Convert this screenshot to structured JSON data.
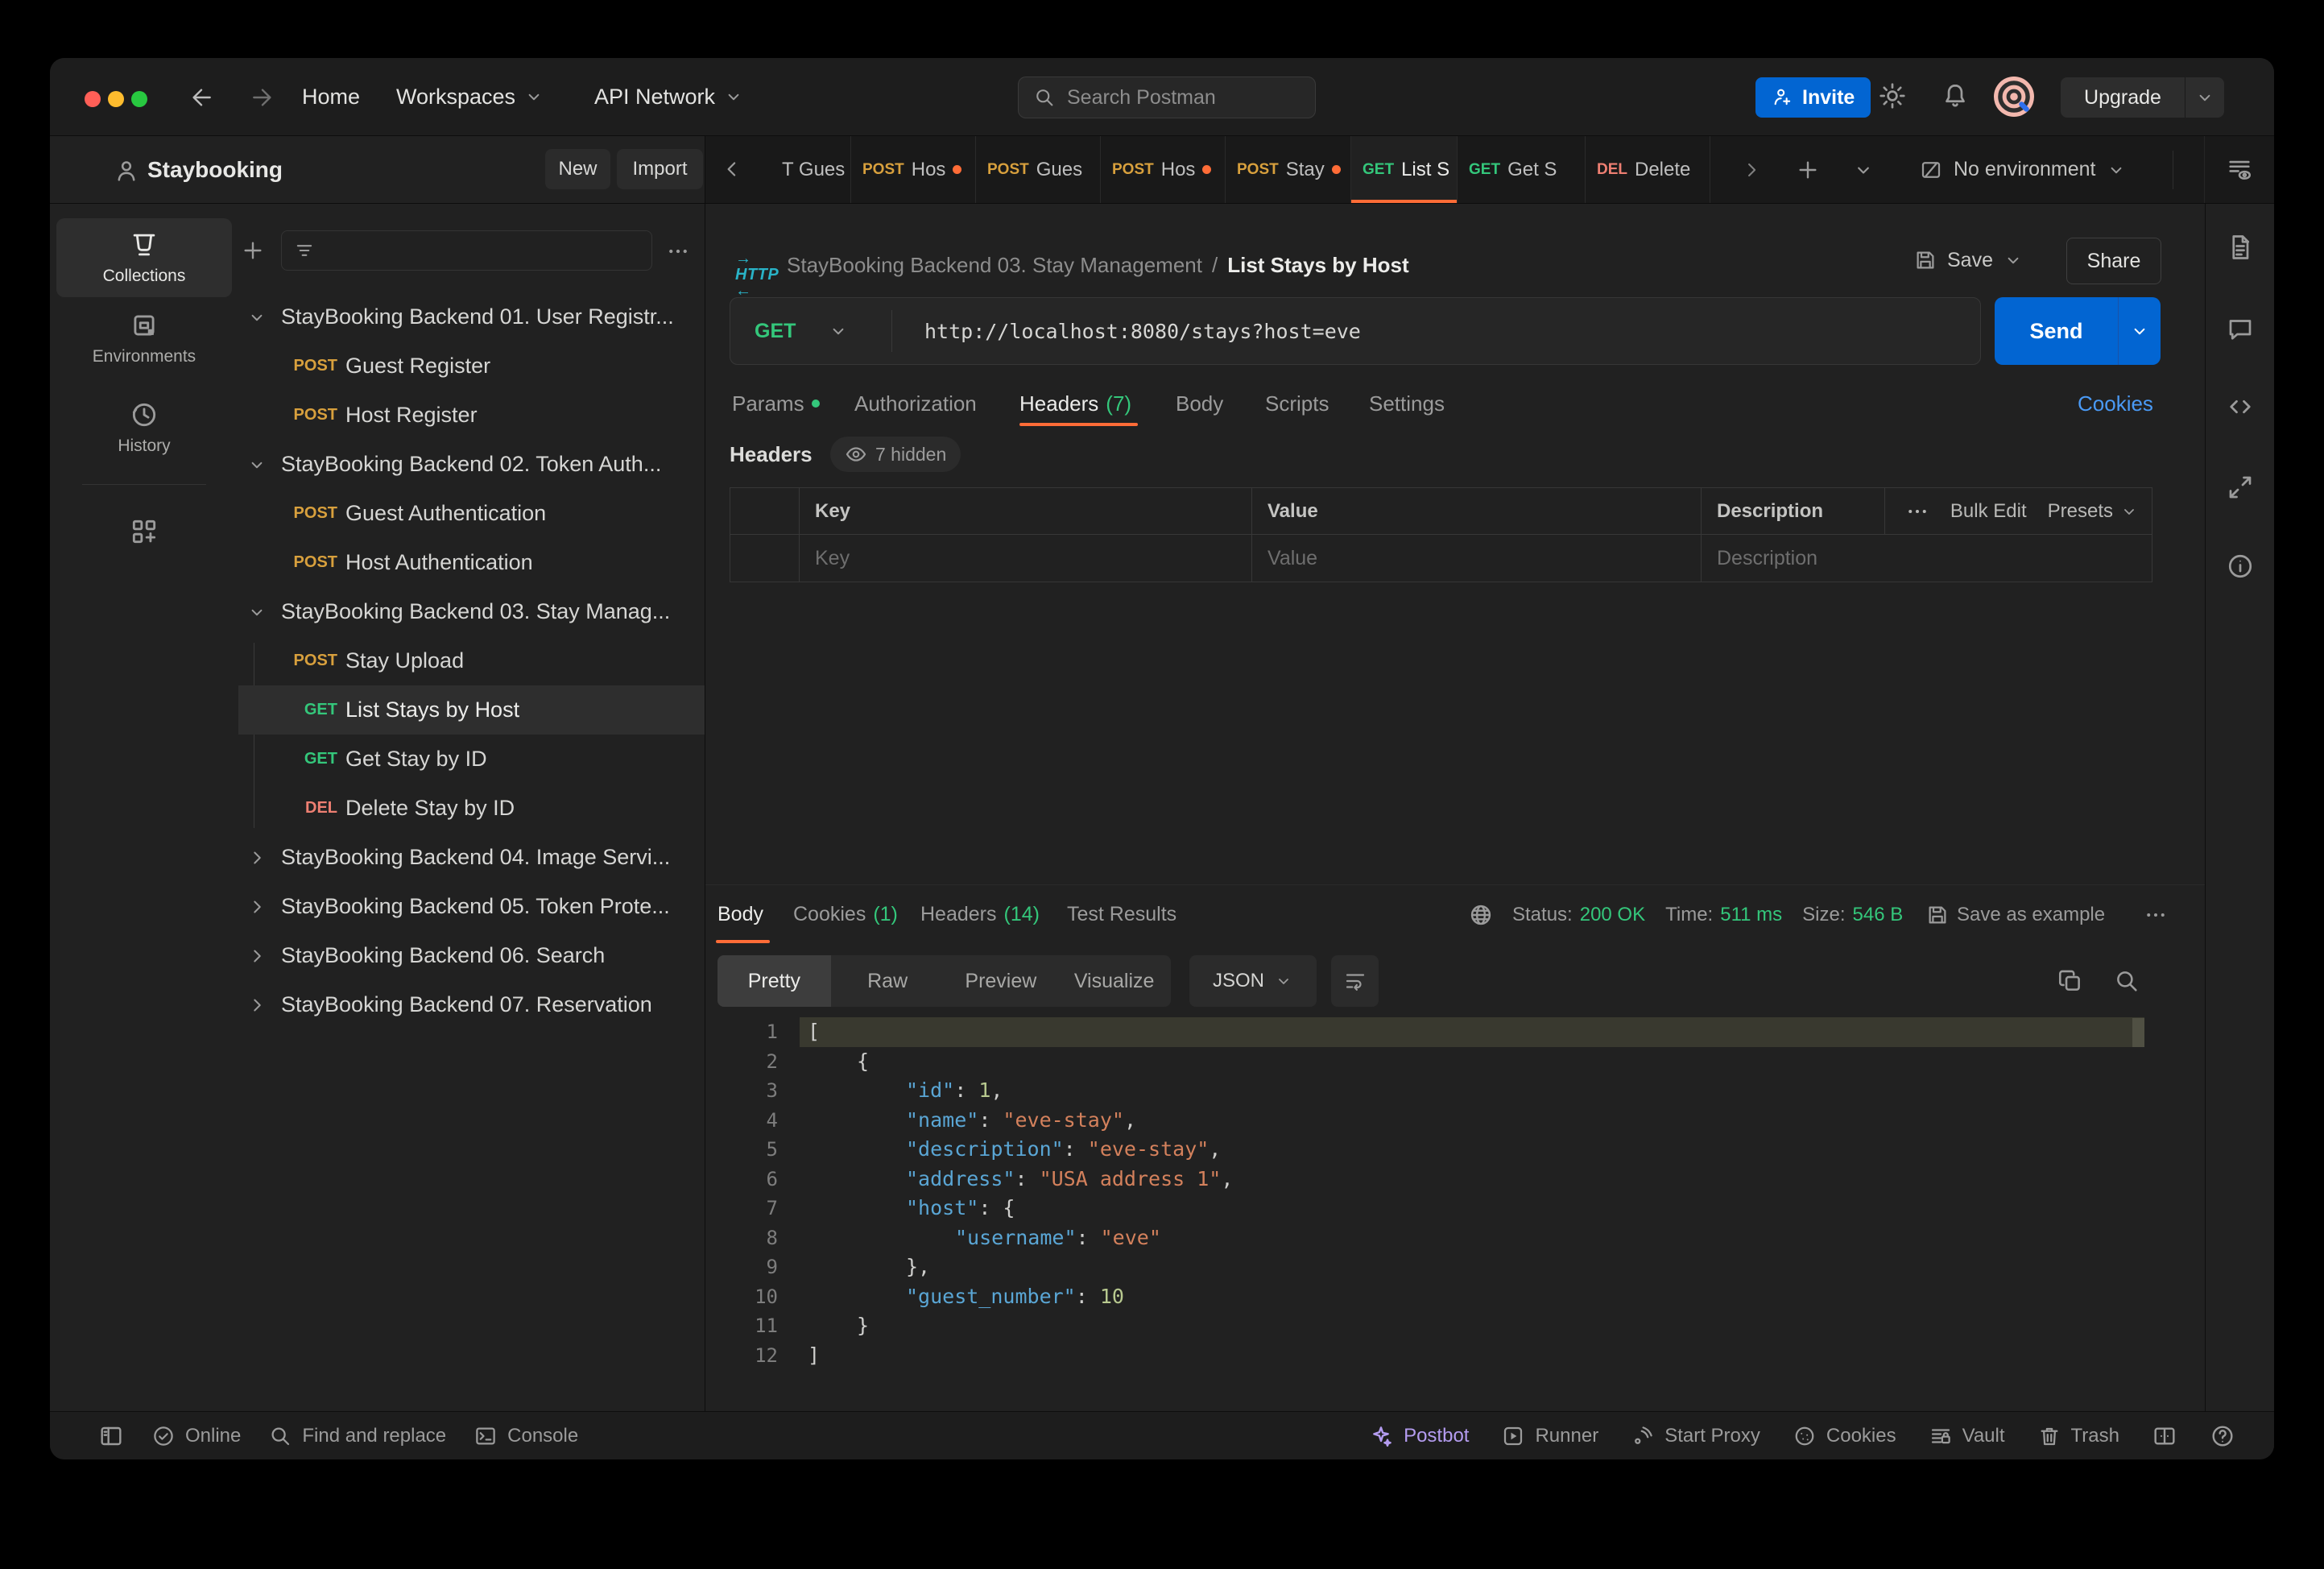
{
  "topbar": {
    "nav": {
      "home": "Home",
      "workspaces": "Workspaces",
      "api_network": "API Network"
    },
    "search_placeholder": "Search Postman",
    "invite_label": "Invite",
    "upgrade_label": "Upgrade"
  },
  "workspace": {
    "name": "Staybooking",
    "new_label": "New",
    "import_label": "Import"
  },
  "rail": {
    "collections": "Collections",
    "environments": "Environments",
    "history": "History"
  },
  "tabstrip": {
    "tabs": [
      {
        "method": "",
        "label": "T Gues"
      },
      {
        "method": "POST",
        "label": "Hos"
      },
      {
        "method": "POST",
        "label": "Gues"
      },
      {
        "method": "POST",
        "label": "Hos"
      },
      {
        "method": "POST",
        "label": "Stay"
      },
      {
        "method": "GET",
        "label": "List S"
      },
      {
        "method": "GET",
        "label": "Get S"
      },
      {
        "method": "DEL",
        "label": "Delete"
      }
    ],
    "environment": "No environment"
  },
  "tree": {
    "items": [
      {
        "method": "",
        "label": "StayBooking Backend 01. User Registr..."
      },
      {
        "method": "POST",
        "label": "Guest Register"
      },
      {
        "method": "POST",
        "label": "Host Register"
      },
      {
        "method": "",
        "label": "StayBooking Backend 02. Token Auth..."
      },
      {
        "method": "POST",
        "label": "Guest Authentication"
      },
      {
        "method": "POST",
        "label": "Host Authentication"
      },
      {
        "method": "",
        "label": "StayBooking Backend 03. Stay Manag..."
      },
      {
        "method": "POST",
        "label": "Stay Upload"
      },
      {
        "method": "GET",
        "label": "List Stays by Host"
      },
      {
        "method": "GET",
        "label": "Get Stay by ID"
      },
      {
        "method": "DEL",
        "label": "Delete Stay by ID"
      },
      {
        "method": "",
        "label": "StayBooking Backend 04. Image Servi..."
      },
      {
        "method": "",
        "label": "StayBooking Backend 05. Token Prote..."
      },
      {
        "method": "",
        "label": "StayBooking Backend 06. Search"
      },
      {
        "method": "",
        "label": "StayBooking Backend 07. Reservation"
      }
    ]
  },
  "request": {
    "breadcrumb": {
      "collection": "StayBooking Backend 03. Stay Management",
      "separator": "/",
      "name": "List Stays by Host"
    },
    "save_label": "Save",
    "share_label": "Share",
    "method": "GET",
    "url": "http://localhost:8080/stays?host=eve",
    "send_label": "Send",
    "tabs": {
      "params": "Params",
      "authorization": "Authorization",
      "headers": "Headers",
      "headers_count": "(7)",
      "body": "Body",
      "scripts": "Scripts",
      "settings": "Settings",
      "cookies_link": "Cookies"
    },
    "headers_editor": {
      "title": "Headers",
      "hidden_label": "7 hidden",
      "columns": {
        "key": "Key",
        "value": "Value",
        "description": "Description"
      },
      "bulk_edit": "Bulk Edit",
      "presets": "Presets",
      "placeholders": {
        "key": "Key",
        "value": "Value",
        "description": "Description"
      }
    }
  },
  "response": {
    "tabs": {
      "body": "Body",
      "cookies": "Cookies",
      "cookies_count": "(1)",
      "headers": "Headers",
      "headers_count": "(14)",
      "test_results": "Test Results"
    },
    "meta": {
      "status_label": "Status:",
      "status_value": "200 OK",
      "time_label": "Time:",
      "time_value": "511 ms",
      "size_label": "Size:",
      "size_value": "546 B",
      "save_as_example": "Save as example"
    },
    "toolbar": {
      "pretty": "Pretty",
      "raw": "Raw",
      "preview": "Preview",
      "visualize": "Visualize",
      "format": "JSON"
    },
    "code_lines": [
      {
        "n": "1",
        "tokens": [
          {
            "t": "pun",
            "v": "["
          }
        ]
      },
      {
        "n": "2",
        "tokens": [
          {
            "t": "pun",
            "v": "{"
          }
        ]
      },
      {
        "n": "3",
        "tokens": [
          {
            "t": "key",
            "v": "\"id\""
          },
          {
            "t": "pun",
            "v": ": "
          },
          {
            "t": "num",
            "v": "1"
          },
          {
            "t": "pun",
            "v": ","
          }
        ]
      },
      {
        "n": "4",
        "tokens": [
          {
            "t": "key",
            "v": "\"name\""
          },
          {
            "t": "pun",
            "v": ": "
          },
          {
            "t": "str",
            "v": "\"eve-stay\""
          },
          {
            "t": "pun",
            "v": ","
          }
        ]
      },
      {
        "n": "5",
        "tokens": [
          {
            "t": "key",
            "v": "\"description\""
          },
          {
            "t": "pun",
            "v": ": "
          },
          {
            "t": "str",
            "v": "\"eve-stay\""
          },
          {
            "t": "pun",
            "v": ","
          }
        ]
      },
      {
        "n": "6",
        "tokens": [
          {
            "t": "key",
            "v": "\"address\""
          },
          {
            "t": "pun",
            "v": ": "
          },
          {
            "t": "str",
            "v": "\"USA address 1\""
          },
          {
            "t": "pun",
            "v": ","
          }
        ]
      },
      {
        "n": "7",
        "tokens": [
          {
            "t": "key",
            "v": "\"host\""
          },
          {
            "t": "pun",
            "v": ": {"
          }
        ]
      },
      {
        "n": "8",
        "tokens": [
          {
            "t": "key",
            "v": "\"username\""
          },
          {
            "t": "pun",
            "v": ": "
          },
          {
            "t": "str",
            "v": "\"eve\""
          }
        ]
      },
      {
        "n": "9",
        "tokens": [
          {
            "t": "pun",
            "v": "},"
          }
        ]
      },
      {
        "n": "10",
        "tokens": [
          {
            "t": "key",
            "v": "\"guest_number\""
          },
          {
            "t": "pun",
            "v": ": "
          },
          {
            "t": "num",
            "v": "10"
          }
        ]
      },
      {
        "n": "11",
        "tokens": [
          {
            "t": "pun",
            "v": "}"
          }
        ]
      },
      {
        "n": "12",
        "tokens": [
          {
            "t": "pun",
            "v": "]"
          }
        ]
      }
    ]
  },
  "statusbar": {
    "online": "Online",
    "find_and_replace": "Find and replace",
    "console": "Console",
    "postbot": "Postbot",
    "runner": "Runner",
    "start_proxy": "Start Proxy",
    "cookies": "Cookies",
    "vault": "Vault",
    "trash": "Trash"
  },
  "colors": {
    "accent_orange": "#ff6c37",
    "primary_blue": "#0265d2",
    "method_get": "#34c77b",
    "method_post": "#d8a03d",
    "method_del": "#ee7f72",
    "status_green": "#34c77b",
    "http_cyan": "#29b3c7"
  }
}
